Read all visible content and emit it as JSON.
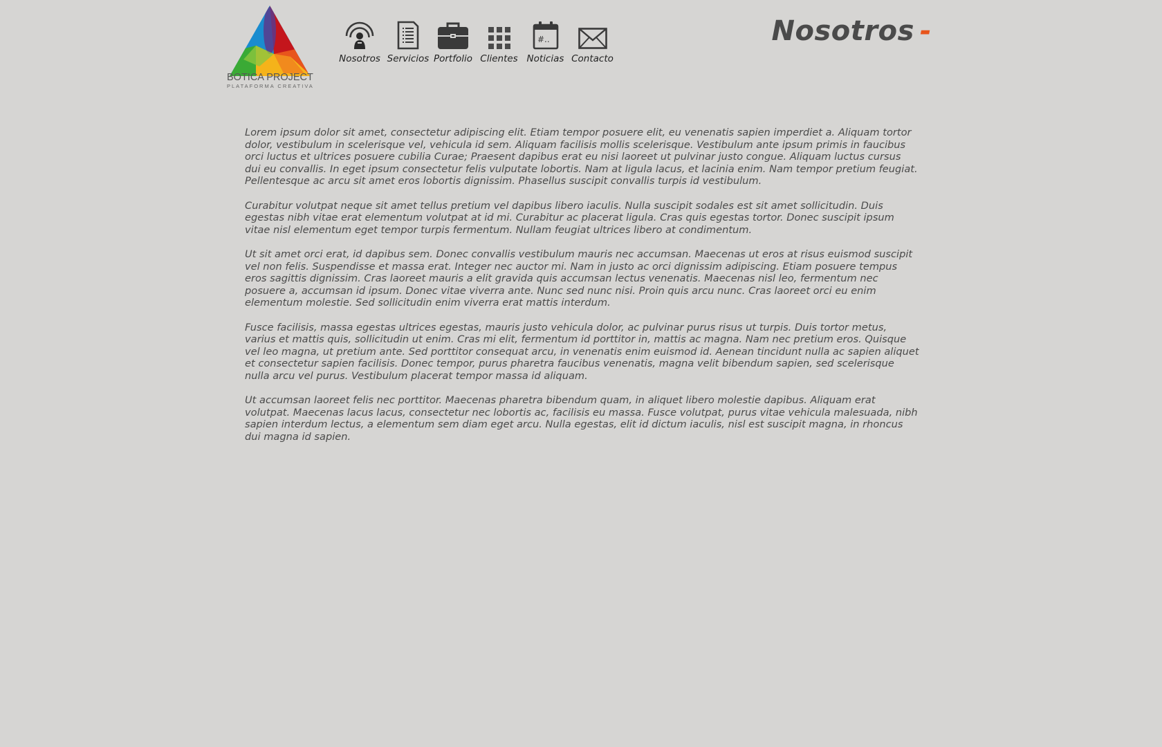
{
  "brand": {
    "name": "BOTICA PROJECT",
    "tagline": "PLATAFORMA CREATIVA",
    "colors": {
      "blue": "#1a8ccf",
      "purple": "#5a3a8c",
      "red": "#c4161c",
      "orange": "#e8551c",
      "yellow": "#f5b31a",
      "green": "#3aaa35"
    }
  },
  "nav": {
    "items": [
      {
        "label": "Nosotros",
        "icon": "person-broadcast-icon"
      },
      {
        "label": "Servicios",
        "icon": "document-list-icon"
      },
      {
        "label": "Portfolio",
        "icon": "briefcase-icon"
      },
      {
        "label": "Clientes",
        "icon": "grid-icon"
      },
      {
        "label": "Noticias",
        "icon": "calendar-icon"
      },
      {
        "label": "Contacto",
        "icon": "envelope-icon"
      }
    ]
  },
  "heading": {
    "title": "Nosotros",
    "dash": "-",
    "accent_color": "#e8551c"
  },
  "content": {
    "paragraphs": [
      "Lorem ipsum dolor sit amet, consectetur adipiscing elit. Etiam tempor posuere elit, eu venenatis sapien imperdiet a. Aliquam tortor dolor, vestibulum in scelerisque vel, vehicula id sem. Aliquam facilisis mollis scelerisque. Vestibulum ante ipsum primis in faucibus orci luctus et ultrices posuere cubilia Curae; Praesent dapibus erat eu nisi laoreet ut pulvinar justo congue. Aliquam luctus cursus dui eu convallis. In eget ipsum consectetur felis vulputate lobortis. Nam at ligula lacus, et lacinia enim. Nam tempor pretium feugiat. Pellentesque ac arcu sit amet eros lobortis dignissim. Phasellus suscipit convallis turpis id vestibulum.",
      "Curabitur volutpat neque sit amet tellus pretium vel dapibus libero iaculis. Nulla suscipit sodales est sit amet sollicitudin. Duis egestas nibh vitae erat elementum volutpat at id mi. Curabitur ac placerat ligula. Cras quis egestas tortor. Donec suscipit ipsum vitae nisl elementum eget tempor turpis fermentum. Nullam feugiat ultrices libero at condimentum.",
      "Ut sit amet orci erat, id dapibus sem. Donec convallis vestibulum mauris nec accumsan. Maecenas ut eros at risus euismod suscipit vel non felis. Suspendisse et massa erat. Integer nec auctor mi. Nam in justo ac orci dignissim adipiscing. Etiam posuere tempus eros sagittis dignissim. Cras laoreet mauris a elit gravida quis accumsan lectus venenatis. Maecenas nisl leo, fermentum nec posuere a, accumsan id ipsum. Donec vitae viverra ante. Nunc sed nunc nisi. Proin quis arcu nunc. Cras laoreet orci eu enim elementum molestie. Sed sollicitudin enim viverra erat mattis interdum.",
      "Fusce facilisis, massa egestas ultrices egestas, mauris justo vehicula dolor, ac pulvinar purus risus ut turpis. Duis tortor metus, varius et mattis quis, sollicitudin ut enim. Cras mi elit, fermentum id porttitor in, mattis ac magna. Nam nec pretium eros. Quisque vel leo magna, ut pretium ante. Sed porttitor consequat arcu, in venenatis enim euismod id. Aenean tincidunt nulla ac sapien aliquet et consectetur sapien facilisis. Donec tempor, purus pharetra faucibus venenatis, magna velit bibendum sapien, sed scelerisque nulla arcu vel purus. Vestibulum placerat tempor massa id aliquam.",
      "Ut accumsan laoreet felis nec porttitor. Maecenas pharetra bibendum quam, in aliquet libero molestie dapibus. Aliquam erat volutpat. Maecenas lacus lacus, consectetur nec lobortis ac, facilisis eu massa. Fusce volutpat, purus vitae vehicula malesuada, nibh sapien interdum lectus, a elementum sem diam eget arcu. Nulla egestas, elit id dictum iaculis, nisl est suscipit magna, in rhoncus dui magna id sapien."
    ]
  }
}
